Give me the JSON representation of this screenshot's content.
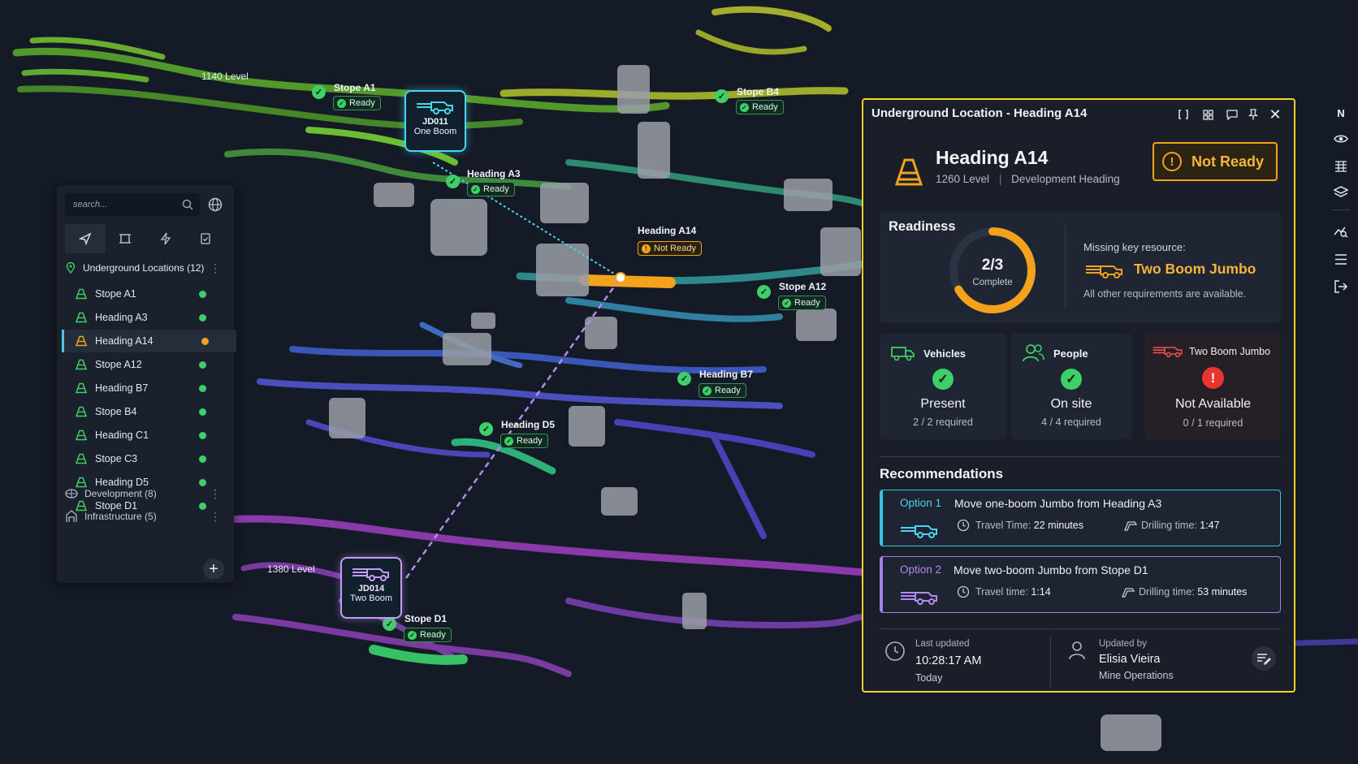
{
  "map": {
    "levels": [
      "1140 Level",
      "1380 Level"
    ],
    "markers": [
      {
        "label": "Stope A1",
        "status": "Ready"
      },
      {
        "label": "Stope B4",
        "status": "Ready"
      },
      {
        "label": "Heading A3",
        "status": "Ready"
      },
      {
        "label": "Heading A14",
        "status": "Not Ready"
      },
      {
        "label": "Stope A12",
        "status": "Ready"
      },
      {
        "label": "Heading B7",
        "status": "Ready"
      },
      {
        "label": "Heading D5",
        "status": "Ready"
      },
      {
        "label": "Stope D1",
        "status": "Ready"
      }
    ],
    "vehicles": [
      {
        "id": "JD011",
        "type": "One Boom"
      },
      {
        "id": "JD014",
        "type": "Two Boom"
      }
    ],
    "colors": {
      "ready": "#3ecf68",
      "not_ready": "#f2a21b",
      "selected_frame": "#f5d327",
      "option1": "#38c4dd",
      "option2": "#a57ee6"
    }
  },
  "sidebar": {
    "search_placeholder": "search...",
    "tabs": [
      "navigate-icon",
      "frame-icon",
      "bolt-icon",
      "checklist-icon"
    ],
    "group_title": "Underground Locations (12)",
    "items": [
      {
        "label": "Stope A1",
        "status": "ready"
      },
      {
        "label": "Heading A3",
        "status": "ready"
      },
      {
        "label": "Heading A14",
        "status": "not-ready"
      },
      {
        "label": "Stope A12",
        "status": "ready"
      },
      {
        "label": "Heading B7",
        "status": "ready"
      },
      {
        "label": "Stope B4",
        "status": "ready"
      },
      {
        "label": "Heading C1",
        "status": "ready"
      },
      {
        "label": "Stope C3",
        "status": "ready"
      },
      {
        "label": "Heading D5",
        "status": "ready"
      },
      {
        "label": "Stope D1",
        "status": "ready"
      }
    ],
    "groups": [
      "Development (8)",
      "Infrastructure (5)"
    ]
  },
  "detail": {
    "window_title": "Underground Location - Heading A14",
    "name": "Heading A14",
    "level": "1260 Level",
    "separator": "|",
    "kind": "Development Heading",
    "status": "Not Ready",
    "readiness": {
      "title": "Readiness",
      "fraction": "2/3",
      "fraction_value": 0.667,
      "complete_label": "Complete",
      "missing_label": "Missing key resource:",
      "missing_resource": "Two Boom Jumbo",
      "note": "All other requirements are available."
    },
    "resources": [
      {
        "title": "Vehicles",
        "status": "Present",
        "detail": "2 / 2 required"
      },
      {
        "title": "People",
        "status": "On site",
        "detail": "4 / 4 required"
      },
      {
        "title": "Two Boom Jumbo",
        "status": "Not Available",
        "detail": "0 / 1 required"
      }
    ],
    "recommendations": {
      "title": "Recommendations",
      "options": [
        {
          "tag": "Option 1",
          "text": "Move one-boom Jumbo from Heading A3",
          "travel_label": "Travel Time:",
          "travel": "22 minutes",
          "drill_label": "Drilling time:",
          "drill": "1:47"
        },
        {
          "tag": "Option 2",
          "text": "Move two-boom Jumbo from Stope D1",
          "travel_label": "Travel time:",
          "travel": "1:14",
          "drill_label": "Drilling time:",
          "drill": "53 minutes"
        }
      ]
    },
    "footer": {
      "updated_label": "Last updated",
      "updated_time": "10:28:17 AM",
      "updated_day": "Today",
      "by_label": "Updated by",
      "by_name": "Elisia Vieira",
      "by_team": "Mine Operations"
    }
  },
  "rail": {
    "compass": "N",
    "icons": [
      "eye-icon",
      "grid-icon",
      "layers-icon",
      "analytics-icon",
      "list-icon",
      "logout-icon"
    ]
  }
}
